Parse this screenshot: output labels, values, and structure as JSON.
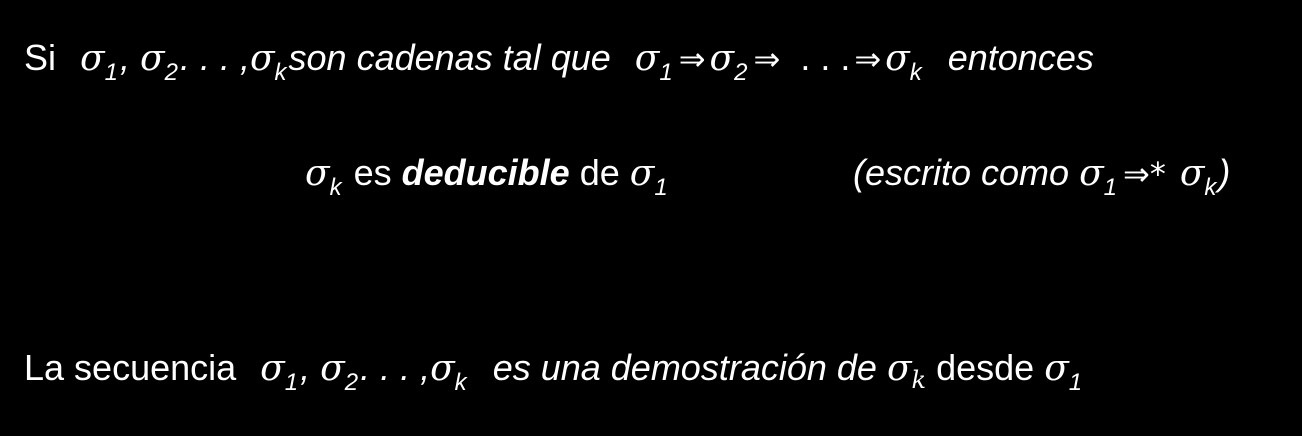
{
  "line1": {
    "si": "Si",
    "sigma": "σ",
    "one": "1",
    "two": "2",
    "k": "k",
    "comma": ",",
    "ellipsis_comma": ". . . ,",
    "son_cadenas": "son cadenas  tal que",
    "arrow": "⇒",
    "dots": ". . .",
    "entonces": "entonces"
  },
  "line2": {
    "sigma": "σ",
    "k": "k",
    "es": "es",
    "deducible": "deducible",
    "de": "de",
    "one": "1"
  },
  "line3": {
    "open": "(escrito como",
    "sigma": "σ",
    "one": "1",
    "arrow_star": "⇒*",
    "k": "k",
    "close": ")"
  },
  "line4": {
    "la_secuencia": "La secuencia",
    "sigma": "σ",
    "one": "1",
    "two": "2",
    "k": "k",
    "comma": ",",
    "ellipsis_comma": ". . . ,",
    "es_una": "es una demostración de",
    "desde": "desde"
  }
}
